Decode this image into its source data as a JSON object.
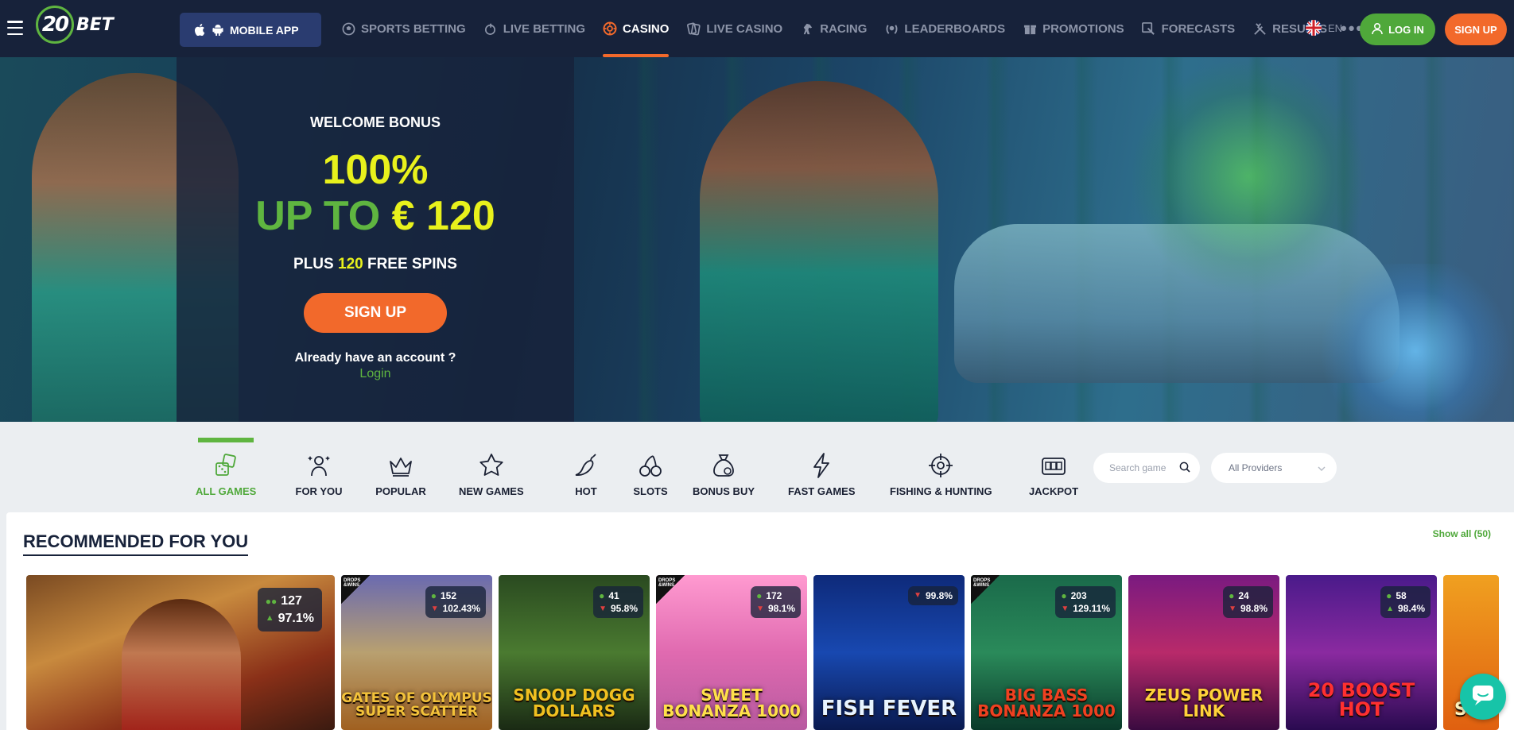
{
  "header": {
    "logo_number": "20",
    "logo_text": "BET",
    "mobile_app_label": "MOBILE APP",
    "nav": [
      {
        "label": "SPORTS BETTING",
        "icon": "soccer-ball-icon"
      },
      {
        "label": "LIVE BETTING",
        "icon": "live-ball-icon"
      },
      {
        "label": "CASINO",
        "icon": "casino-chip-icon",
        "active": true
      },
      {
        "label": "LIVE CASINO",
        "icon": "live-cards-icon"
      },
      {
        "label": "RACING",
        "icon": "horse-icon"
      },
      {
        "label": "LEADERBOARDS",
        "icon": "laurel-icon"
      },
      {
        "label": "PROMOTIONS",
        "icon": "gift-icon"
      },
      {
        "label": "FORECASTS",
        "icon": "forecast-icon"
      },
      {
        "label": "RESULTS",
        "icon": "results-icon"
      }
    ],
    "more_label": "•••",
    "language": "EN",
    "login_label": "LOG IN",
    "signup_label": "SIGN UP"
  },
  "hero": {
    "welcome": "WELCOME BONUS",
    "percent": "100%",
    "up_to": "UP TO",
    "amount": "€ 120",
    "plus": "PLUS",
    "spins_count": "120",
    "spins_label": "FREE SPINS",
    "signup_label": "SIGN UP",
    "already": "Already have an account ?",
    "login_link": "Login"
  },
  "categories": [
    {
      "label": "ALL GAMES",
      "icon": "dice-icon",
      "active": true
    },
    {
      "label": "FOR YOU",
      "icon": "person-sparkle-icon"
    },
    {
      "label": "POPULAR",
      "icon": "crown-icon"
    },
    {
      "label": "NEW GAMES",
      "icon": "star-icon"
    },
    {
      "label": "HOT",
      "icon": "chili-icon"
    },
    {
      "label": "SLOTS",
      "icon": "cherries-icon"
    },
    {
      "label": "BONUS BUY",
      "icon": "money-bag-icon"
    },
    {
      "label": "FAST GAMES",
      "icon": "lightning-icon"
    },
    {
      "label": "FISHING & HUNTING",
      "icon": "crosshair-icon"
    },
    {
      "label": "JACKPOT",
      "icon": "slot-machine-icon"
    }
  ],
  "search_placeholder": "Search game",
  "providers_selected": "All Providers",
  "recommended": {
    "title": "RECOMMENDED FOR YOU",
    "show_all": "Show all",
    "count": "(50)",
    "games": [
      {
        "title": "",
        "players": "127",
        "rtp": "97.1%",
        "trend": "up",
        "drops": false
      },
      {
        "title": "GATES OF OLYMPUS SUPER SCATTER",
        "players": "152",
        "rtp": "102.43%",
        "trend": "down",
        "drops": true
      },
      {
        "title": "SNOOP DOGG DOLLARS",
        "players": "41",
        "rtp": "95.8%",
        "trend": "down",
        "drops": false
      },
      {
        "title": "SWEET BONANZA 1000",
        "players": "172",
        "rtp": "98.1%",
        "trend": "down",
        "drops": true
      },
      {
        "title": "FISH FEVER",
        "players": "",
        "rtp": "99.8%",
        "trend": "down",
        "drops": false
      },
      {
        "title": "BIG BASS BONANZA 1000",
        "players": "203",
        "rtp": "129.11%",
        "trend": "down",
        "drops": true
      },
      {
        "title": "ZEUS POWER LINK",
        "players": "24",
        "rtp": "98.8%",
        "trend": "down",
        "drops": false
      },
      {
        "title": "20 BOOST HOT",
        "players": "58",
        "rtp": "98.4%",
        "trend": "up",
        "drops": false
      },
      {
        "title": "SUN",
        "players": "",
        "rtp": "",
        "trend": "",
        "drops": false
      }
    ]
  },
  "colors": {
    "header_bg": "#17223a",
    "accent_orange": "#f2692b",
    "accent_green": "#5fb540",
    "accent_yellow": "#e8f11c"
  }
}
